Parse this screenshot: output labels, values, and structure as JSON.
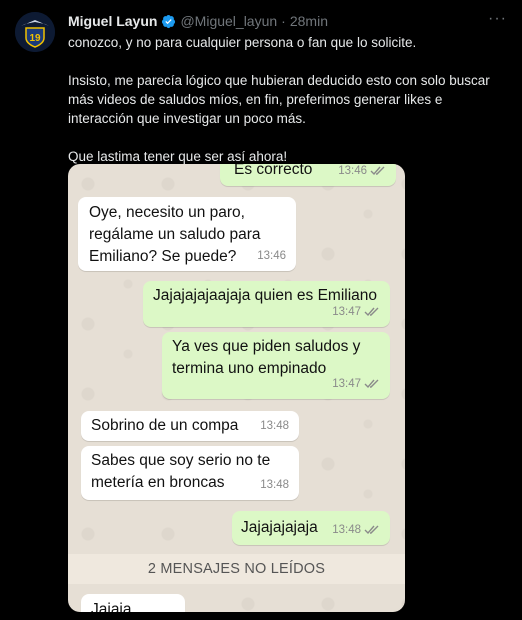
{
  "tweet": {
    "author_name": "Miguel Layun",
    "handle": "@Miguel_layun",
    "separator": "·",
    "time": "28min",
    "more_label": "···",
    "avatar_text": "19",
    "paragraphs": [
      "conozco, y no para cualquier persona o fan que lo solicite.",
      "Insisto, me parecía lógico que hubieran deducido esto con solo buscar más videos de saludos míos, en fin, preferimos generar likes e interacción que investigar un poco más.",
      "Que lastima tener que ser así ahora!"
    ]
  },
  "chat": {
    "messages": [
      {
        "dir": "out",
        "text": "Es correcto",
        "time": "13:46",
        "ticks": "double-check-icon"
      },
      {
        "dir": "in",
        "text": "Oye, necesito un paro, regálame un saludo para Emiliano? Se puede?",
        "time": "13:46"
      },
      {
        "dir": "out",
        "text": "Jajajajajaajaja quien es Emiliano",
        "time": "13:47",
        "ticks": "double-check-icon"
      },
      {
        "dir": "out",
        "text": "Ya ves que piden saludos y termina uno empinado",
        "time": "13:47",
        "ticks": "double-check-icon"
      },
      {
        "dir": "in",
        "text": "Sobrino de un compa",
        "time": "13:48"
      },
      {
        "dir": "in",
        "text": "Sabes que soy serio no te metería en broncas",
        "time": "13:48"
      },
      {
        "dir": "out",
        "text": "Jajajajajaja",
        "time": "13:48",
        "ticks": "double-check-icon"
      },
      {
        "dir": "in",
        "text": "Jajaja",
        "time": ""
      }
    ],
    "unread_divider": "2 MENSAJES NO LEÍDOS"
  },
  "colors": {
    "background": "#000000",
    "verified": "#1d9bf0",
    "secondary_text": "#71767b",
    "outgoing_bubble": "#dcf8c6",
    "incoming_bubble": "#ffffff",
    "chat_background": "#e6dfd5"
  }
}
